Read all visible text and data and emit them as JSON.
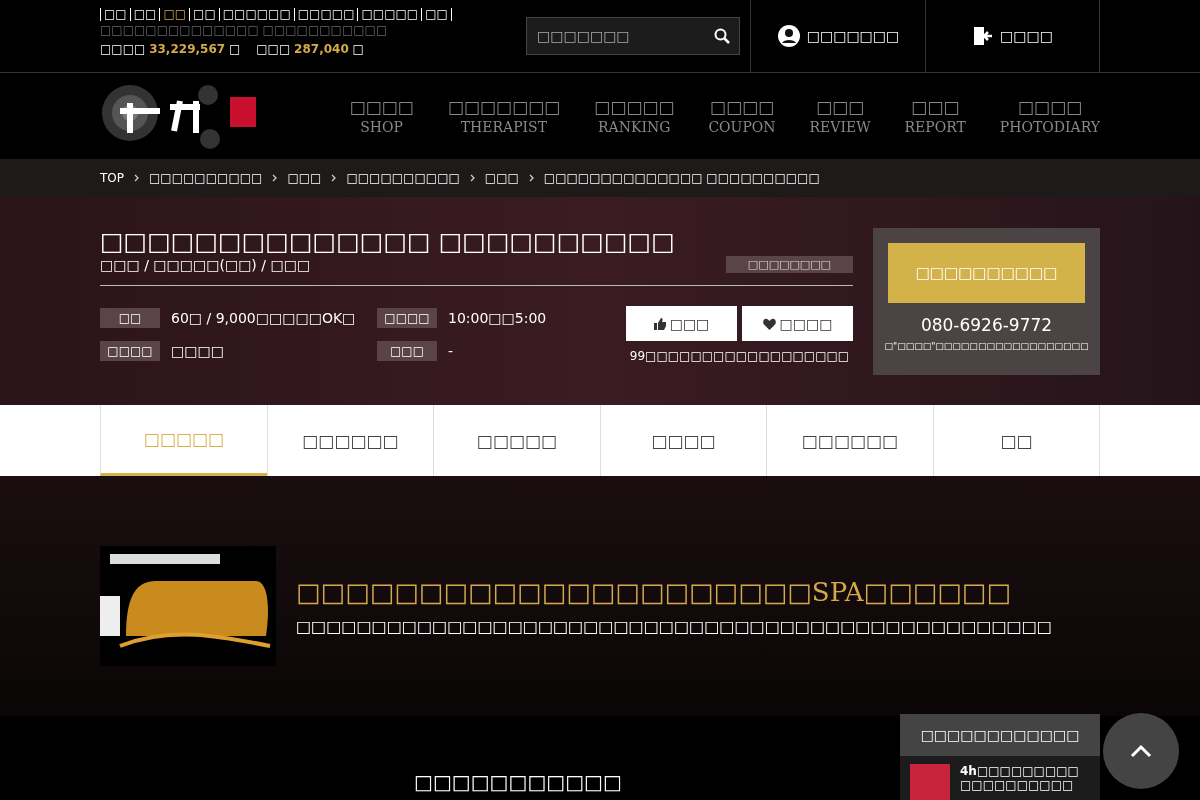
{
  "top_links": [
    {
      "label": "□□",
      "selected": false
    },
    {
      "label": "□□",
      "selected": false
    },
    {
      "label": "□□",
      "selected": true
    },
    {
      "label": "□□",
      "selected": false
    },
    {
      "label": "□□□□□□",
      "selected": false
    },
    {
      "label": "□□□□□",
      "selected": false
    },
    {
      "label": "□□□□□",
      "selected": false
    },
    {
      "label": "□□",
      "selected": false
    }
  ],
  "tagline": "□□□□□□□□□□□□□□ □□□□□□□□□□□",
  "stats": [
    {
      "label": "□□□□",
      "value": "33,229,567",
      "unit": "□"
    },
    {
      "label": "□□□",
      "value": "287,040",
      "unit": "□"
    }
  ],
  "search": {
    "placeholder": "□□□□□□□"
  },
  "account_buttons": [
    {
      "label": "□□□□□□□",
      "kind": "user"
    },
    {
      "label": "□□□□",
      "kind": "login"
    }
  ],
  "nav": [
    {
      "label": "□□□□",
      "sub": "SHOP"
    },
    {
      "label": "□□□□□□□",
      "sub": "THERAPIST"
    },
    {
      "label": "□□□□□",
      "sub": "RANKING"
    },
    {
      "label": "□□□□",
      "sub": "COUPON"
    },
    {
      "label": "□□□",
      "sub": "REVIEW"
    },
    {
      "label": "□□□",
      "sub": "REPORT"
    },
    {
      "label": "□□□□",
      "sub": "PHOTODIARY"
    }
  ],
  "breadcrumb": [
    "TOP",
    "□□□□□□□□□□",
    "□□□",
    "□□□□□□□□□□",
    "□□□",
    "□□□□□□□□□□□□□□ □□□□□□□□□□"
  ],
  "shop": {
    "title": "□□□□□□□□□□□□□□ □□□□□□□□□□",
    "area": "□□□ / □□□□□(□□) / □□□",
    "badge": "□□□□□□□□",
    "info": [
      {
        "label": "□□",
        "value": "60□ / 9,000□□□□□OK□"
      },
      {
        "label": "□□□□",
        "value": "10:00□□5:00"
      },
      {
        "label": "□□□□",
        "value": "□□□□"
      },
      {
        "label": "□□□",
        "value": "-"
      }
    ],
    "actions": [
      {
        "label": "□□□",
        "kind": "like"
      },
      {
        "label": "□□□□",
        "kind": "favorite"
      }
    ],
    "action_note": "99□□□□□□□□□□□□□□□□□□",
    "call_button": "□□□□□□□□□□",
    "phone": "080-6926-9772",
    "phone_note": "□\"□□□□\"□□□□□□□□□□□□□□□□□□"
  },
  "tabs": [
    {
      "label": "□□□□□",
      "selected": true
    },
    {
      "label": "□□□□□□",
      "selected": false
    },
    {
      "label": "□□□□□",
      "selected": false
    },
    {
      "label": "□□□□",
      "selected": false
    },
    {
      "label": "□□□□□□",
      "selected": false
    },
    {
      "label": "□□",
      "selected": false
    }
  ],
  "hero": {
    "title": "□□□□□□□□□□□□□□□□□□□□□SPA□□□□□□",
    "subtitle": "□□□□□□□□□□□□□□□□□□□□□□□□□□□□□□□□□□□□□□□□□□□□□□□□□□"
  },
  "section_title": "□□□□□□□□□□□",
  "side_panel": {
    "title": "□□□□□□□□□□□□",
    "items": [
      {
        "text": "4h□□□□□□□□□□□□□□□□□□□"
      }
    ]
  }
}
